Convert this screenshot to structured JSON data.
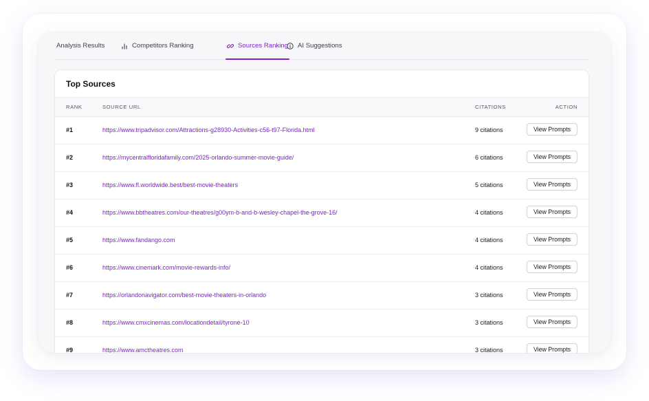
{
  "tabs": [
    {
      "label": "Analysis Results",
      "icon": "none"
    },
    {
      "label": "Competitors Ranking",
      "icon": "bar-chart-icon"
    },
    {
      "label": "Sources Ranking",
      "icon": "link-icon",
      "active": true
    },
    {
      "label": "AI Suggestions",
      "icon": "info-circle-icon"
    }
  ],
  "card": {
    "title": "Top Sources"
  },
  "table": {
    "headers": {
      "rank": "RANK",
      "url": "SOURCE URL",
      "citations": "CITATIONS",
      "action": "ACTION"
    },
    "rows": [
      {
        "rank": "#1",
        "url": "https://www.tripadvisor.com/Attractions-g28930-Activities-c56-t97-Florida.html",
        "citations": "9 citations",
        "action": "View Prompts"
      },
      {
        "rank": "#2",
        "url": "https://mycentralfloridafamily.com/2025-orlando-summer-movie-guide/",
        "citations": "6 citations",
        "action": "View Prompts"
      },
      {
        "rank": "#3",
        "url": "https://www.fl.worldwide.best/best-movie-theaters",
        "citations": "5 citations",
        "action": "View Prompts"
      },
      {
        "rank": "#4",
        "url": "https://www.bbtheatres.com/our-theatres/g00ym-b-and-b-wesley-chapel-the-grove-16/",
        "citations": "4 citations",
        "action": "View Prompts"
      },
      {
        "rank": "#5",
        "url": "https://www.fandango.com",
        "citations": "4 citations",
        "action": "View Prompts"
      },
      {
        "rank": "#6",
        "url": "https://www.cinemark.com/movie-rewards-info/",
        "citations": "4 citations",
        "action": "View Prompts"
      },
      {
        "rank": "#7",
        "url": "https://orlandonavigator.com/best-movie-theaters-in-orlando",
        "citations": "3 citations",
        "action": "View Prompts"
      },
      {
        "rank": "#8",
        "url": "https://www.cmxcinemas.com/locationdetail/tyrone-10",
        "citations": "3 citations",
        "action": "View Prompts"
      },
      {
        "rank": "#9",
        "url": "https://www.amctheatres.com",
        "citations": "3 citations",
        "action": "View Prompts"
      }
    ]
  },
  "colors": {
    "accent": "#7e22ce",
    "text": "#1a1a1a",
    "muted": "#55555f",
    "border": "#ececf0"
  }
}
